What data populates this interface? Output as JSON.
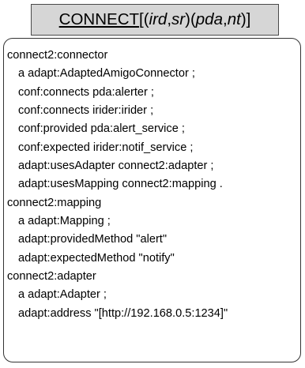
{
  "title": {
    "main": "CONNECT",
    "open": "[(",
    "a1": "ird",
    "comma1": ",",
    "a2": "sr",
    "mid": ")(",
    "b1": "pda",
    "comma2": ",",
    "b2": "nt",
    "close": ")]"
  },
  "lines": [
    {
      "text": "connect2:connector",
      "indent": false
    },
    {
      "text": "a  adapt:AdaptedAmigoConnector ;",
      "indent": true
    },
    {
      "text": "conf:connects pda:alerter ;",
      "indent": true
    },
    {
      "text": "conf:connects irider:irider ;",
      "indent": true
    },
    {
      "text": "conf:provided pda:alert_service ;",
      "indent": true
    },
    {
      "text": "conf:expected irider:notif_service ;",
      "indent": true
    },
    {
      "text": "adapt:usesAdapter connect2:adapter ;",
      "indent": true
    },
    {
      "text": "adapt:usesMapping connect2:mapping .",
      "indent": true
    },
    {
      "text": "connect2:mapping",
      "indent": false
    },
    {
      "text": "a adapt:Mapping ;",
      "indent": true
    },
    {
      "text": "adapt:providedMethod \"alert\"",
      "indent": true
    },
    {
      "text": "adapt:expectedMethod \"notify\"",
      "indent": true
    },
    {
      "text": "connect2:adapter",
      "indent": false
    },
    {
      "text": "a adapt:Adapter ;",
      "indent": true
    },
    {
      "text": "adapt:address \"[http://192.168.0.5:1234]\"",
      "indent": true
    }
  ]
}
